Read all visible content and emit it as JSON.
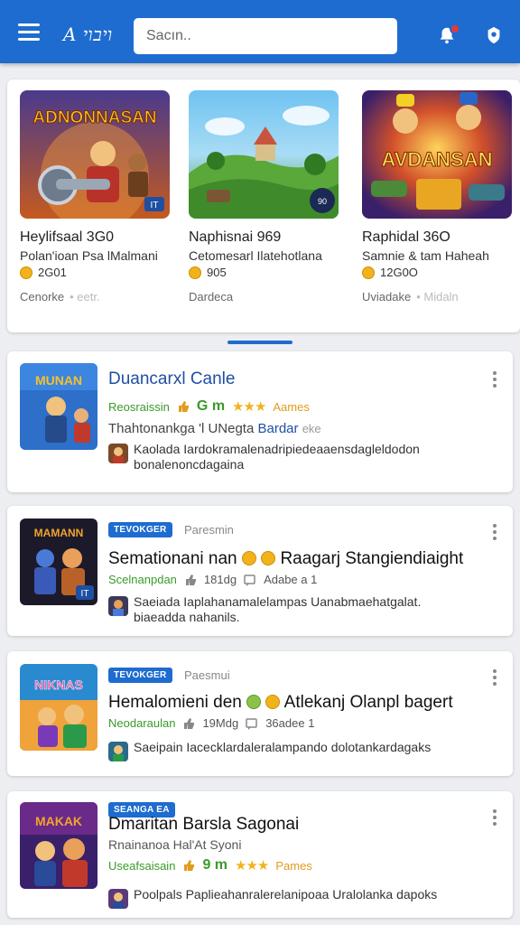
{
  "app": {
    "logo_text": "A ויבוי"
  },
  "search": {
    "placeholder": "Sacın.."
  },
  "featured": [
    {
      "title": "Heylifsaal 3G0",
      "subtitle": "Polan'ioan Psa lMalmani",
      "rating": "2G01",
      "meta": "Cenorke",
      "meta_faded": "• eetr.",
      "art": "warrior"
    },
    {
      "title": "Naphisnai 969",
      "subtitle": "Cetomesarl Ilatehotlana",
      "rating": "905",
      "meta": "Dardeca",
      "meta_faded": "",
      "art": "landscape"
    },
    {
      "title": "Raphidal 36O",
      "subtitle": "Samnie & tam Haheah",
      "rating": "12G0O",
      "meta": "Uviadake",
      "meta_faded": "• Midaln",
      "art": "arcade"
    }
  ],
  "featured_thumb_texts": [
    "ADNONNASAN",
    "AVDANSAN"
  ],
  "cards": [
    {
      "title": "Duancarxl Canle",
      "stat_left": "Reosraissin",
      "stat_mid": "G m",
      "stat_stars": "★★★",
      "stat_right": "Aames",
      "desc": "Thahtonankga 'l UNegta",
      "desc_link": "Bardar",
      "desc_tail": "eke",
      "author_line1": "Kaolada Iardokramalenadripiedeaaensdagleldodon",
      "author_line2": "bonalenoncdagaina"
    },
    {
      "badge": "TEVOKGER",
      "badge_side": "Paresmin",
      "title": "Semationani nan",
      "title_tail": "Raagarj Stangiendiaight",
      "stat_left": "Scelnanpdan",
      "stat_mid": "181dg",
      "stat_right": "Adabe a 1",
      "author_line1": "Saeiada Iaplahanamalelampas Uanabmaehatgalat.",
      "author_line2": "biaeadda nahanils."
    },
    {
      "badge": "TEVOKGER",
      "badge_side": "Paesmui",
      "title": "Hemalomieni den",
      "title_tail": "Atlekanj Olanpl bagert",
      "stat_left": "Neodaraulan",
      "stat_mid": "19Mdg",
      "stat_right": "36adee 1",
      "author_line1": "Saeipain Iacecklardaleralampando dolotankardagaks"
    },
    {
      "badge": "SEANGA EA",
      "title": "Dmaritan Barsla Sagonai",
      "subtitle": "Rnainanoa Hal'At Syoni",
      "stat_left": "Useafsaisain",
      "stat_mid": "9 m",
      "stat_stars": "★★★",
      "stat_right": "Pames",
      "author_line1": "Poolpals Paplieahanralerelanipoaa Uralolanka dapoks"
    }
  ],
  "colors": {
    "brand": "#1e6ccf",
    "accent_green": "#3a9a2a",
    "accent_gold": "#f2b21c"
  }
}
